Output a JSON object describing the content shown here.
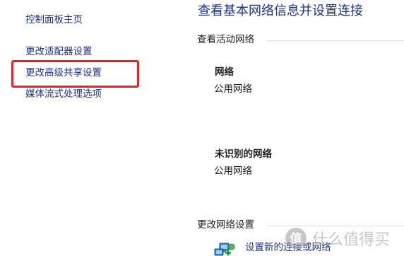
{
  "sidebar": {
    "items": [
      {
        "label": "控制面板主页"
      },
      {
        "label": "更改适配器设置"
      },
      {
        "label": "更改高级共享设置"
      },
      {
        "label": "媒体流式处理选项"
      }
    ]
  },
  "main": {
    "title": "查看基本网络信息并设置连接",
    "active_networks": {
      "header": "查看活动网络",
      "networks": [
        {
          "name": "网络",
          "category": "公用网络"
        },
        {
          "name": "未识别的网络",
          "category": "公用网络"
        }
      ]
    },
    "change_settings": {
      "header": "更改网络设置",
      "items": [
        {
          "label": "设置新的连接或网络",
          "icon": "network-setup-icon"
        }
      ]
    }
  },
  "watermark": {
    "text": "什么值得买",
    "logo": "smzdm-logo"
  },
  "colors": {
    "link": "#1e3287",
    "highlight": "#e8202a",
    "divider": "#dcdcdc"
  }
}
